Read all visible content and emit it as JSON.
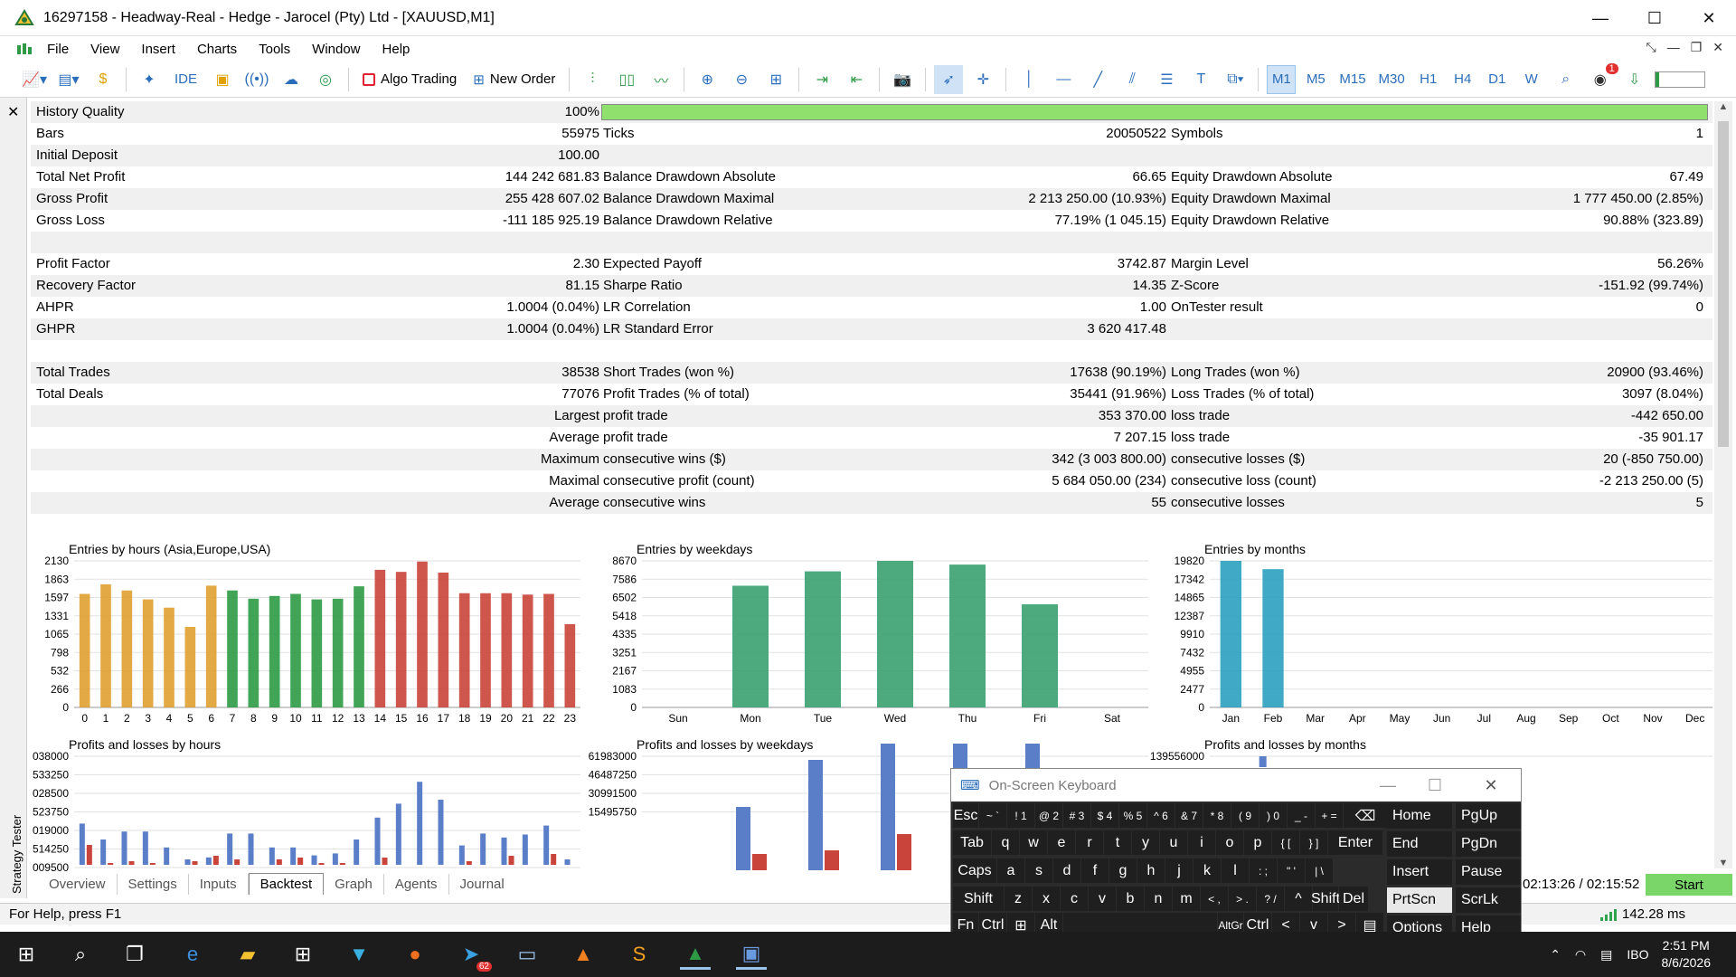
{
  "window": {
    "title": "16297158 - Headway-Real - Hedge - Jarocel (Pty) Ltd - [XAUUSD,M1]",
    "minimize": "—",
    "maximize": "☐",
    "close": "✕"
  },
  "menu": {
    "items": [
      "File",
      "View",
      "Insert",
      "Charts",
      "Tools",
      "Window",
      "Help"
    ]
  },
  "toolbar": {
    "ide_label": "IDE",
    "algo_trading_label": "Algo Trading",
    "new_order_label": "New Order",
    "timeframes": [
      "M1",
      "M5",
      "M15",
      "M30",
      "H1",
      "H4",
      "D1",
      "W"
    ],
    "active_timeframe": "M1",
    "notification_count": "1"
  },
  "sidepanel": {
    "close": "✕",
    "label": "Strategy Tester"
  },
  "report": {
    "rows": [
      {
        "l1": "History Quality",
        "v1": "100%",
        "bar": true,
        "history_quality_fraction": 1.0
      },
      {
        "l1": "Bars",
        "v1": "55975",
        "l2": "Ticks",
        "v2": "20050522",
        "l3": "Symbols",
        "v3": "1"
      },
      {
        "l1": "Initial Deposit",
        "v1": "100.00"
      },
      {
        "l1": "Total Net Profit",
        "v1": "144 242 681.83",
        "l2": "Balance Drawdown Absolute",
        "v2": "66.65",
        "l3": "Equity Drawdown Absolute",
        "v3": "67.49"
      },
      {
        "l1": "Gross Profit",
        "v1": "255 428 607.02",
        "l2": "Balance Drawdown Maximal",
        "v2": "2 213 250.00 (10.93%)",
        "l3": "Equity Drawdown Maximal",
        "v3": "1 777 450.00 (2.85%)"
      },
      {
        "l1": "Gross Loss",
        "v1": "-111 185 925.19",
        "l2": "Balance Drawdown Relative",
        "v2": "77.19% (1 045.15)",
        "l3": "Equity Drawdown Relative",
        "v3": "90.88% (323.89)"
      },
      {},
      {
        "l1": "Profit Factor",
        "v1": "2.30",
        "l2": "Expected Payoff",
        "v2": "3742.87",
        "l3": "Margin Level",
        "v3": "56.26%"
      },
      {
        "l1": "Recovery Factor",
        "v1": "81.15",
        "l2": "Sharpe Ratio",
        "v2": "14.35",
        "l3": "Z-Score",
        "v3": "-151.92 (99.74%)"
      },
      {
        "l1": "AHPR",
        "v1": "1.0004 (0.04%)",
        "l2": "LR Correlation",
        "v2": "1.00",
        "l3": "OnTester result",
        "v3": "0"
      },
      {
        "l1": "GHPR",
        "v1": "1.0004 (0.04%)",
        "l2": "LR Standard Error",
        "v2": "3 620 417.48"
      },
      {},
      {
        "l1": "Total Trades",
        "v1": "38538",
        "l2": "Short Trades (won %)",
        "v2": "17638 (90.19%)",
        "l3": "Long Trades (won %)",
        "v3": "20900 (93.46%)"
      },
      {
        "l1": "Total Deals",
        "v1": "77076",
        "l2": "Profit Trades (% of total)",
        "v2": "35441 (91.96%)",
        "l3": "Loss Trades (% of total)",
        "v3": "3097 (8.04%)"
      },
      {
        "v1": "Largest",
        "l2": "profit trade",
        "v2": "353 370.00",
        "l3": "loss trade",
        "v3": "-442 650.00"
      },
      {
        "v1": "Average",
        "l2": "profit trade",
        "v2": "7 207.15",
        "l3": "loss trade",
        "v3": "-35 901.17"
      },
      {
        "v1": "Maximum",
        "l2": "consecutive wins ($)",
        "v2": "342 (3 003 800.00)",
        "l3": "consecutive losses ($)",
        "v3": "20 (-850 750.00)"
      },
      {
        "v1": "Maximal",
        "l2": "consecutive profit (count)",
        "v2": "5 684 050.00 (234)",
        "l3": "consecutive loss (count)",
        "v3": "-2 213 250.00 (5)"
      },
      {
        "v1": "Average",
        "l2": "consecutive wins",
        "v2": "55",
        "l3": "consecutive losses",
        "v3": "5"
      },
      {}
    ]
  },
  "chart_data": [
    {
      "type": "bar",
      "title": "Entries by hours (Asia,Europe,USA)",
      "categories": [
        "0",
        "1",
        "2",
        "3",
        "4",
        "5",
        "6",
        "7",
        "8",
        "9",
        "10",
        "11",
        "12",
        "13",
        "14",
        "15",
        "16",
        "17",
        "18",
        "19",
        "20",
        "21",
        "22",
        "23"
      ],
      "values": [
        1650,
        1790,
        1700,
        1570,
        1450,
        1170,
        1770,
        1700,
        1580,
        1620,
        1650,
        1570,
        1580,
        1760,
        2000,
        1970,
        2120,
        1960,
        1660,
        1660,
        1660,
        1640,
        1650,
        1210
      ],
      "yticks": [
        "2130",
        "1863",
        "1597",
        "1331",
        "1065",
        "798",
        "532",
        "266",
        "0"
      ],
      "ylim": [
        0,
        2130
      ],
      "colors": {
        "asia": "#e0a030",
        "europe": "#2e9a45",
        "usa": "#c9443a"
      }
    },
    {
      "type": "bar",
      "title": "Entries by weekdays",
      "categories": [
        "Sun",
        "Mon",
        "Tue",
        "Wed",
        "Thu",
        "Fri",
        "Sat"
      ],
      "values": [
        0,
        7200,
        8050,
        8670,
        8450,
        6100,
        0
      ],
      "yticks": [
        "8670",
        "7586",
        "6502",
        "5418",
        "4335",
        "3251",
        "2167",
        "1083",
        "0"
      ],
      "ylim": [
        0,
        8670
      ],
      "colors": {
        "bar": "#3aa070"
      }
    },
    {
      "type": "bar",
      "title": "Entries by months",
      "categories": [
        "Jan",
        "Feb",
        "Mar",
        "Apr",
        "May",
        "Jun",
        "Jul",
        "Aug",
        "Sep",
        "Oct",
        "Nov",
        "Dec"
      ],
      "values": [
        19820,
        18700,
        0,
        0,
        0,
        0,
        0,
        0,
        0,
        0,
        0,
        0
      ],
      "yticks": [
        "19820",
        "17342",
        "14865",
        "12387",
        "9910",
        "7432",
        "4955",
        "2477",
        "0"
      ],
      "ylim": [
        0,
        19820
      ],
      "colors": {
        "bar": "#2aa0c0"
      }
    },
    {
      "type": "bar",
      "title": "Profits and losses by hours",
      "yticks": [
        "038000",
        "533250",
        "028500",
        "523750",
        "019000",
        "514250",
        "009500"
      ],
      "colors": {
        "profit": "#5b7ec9",
        "loss": "#c9443a"
      }
    },
    {
      "type": "bar",
      "title": "Profits and losses by weekdays",
      "yticks": [
        "61983000",
        "46487250",
        "30991500",
        "15495750"
      ],
      "colors": {
        "profit": "#5b7ec9",
        "loss": "#c9443a"
      }
    },
    {
      "type": "bar",
      "title": "Profits and losses by months",
      "yticks": [
        "139556000"
      ],
      "colors": {
        "profit": "#5b7ec9",
        "loss": "#c9443a"
      }
    }
  ],
  "tabs": [
    "Overview",
    "Settings",
    "Inputs",
    "Backtest",
    "Graph",
    "Agents",
    "Journal"
  ],
  "active_tab": "Backtest",
  "timer": "02:13:26 / 02:15:52",
  "start_label": "Start",
  "status": {
    "help": "For Help, press F1",
    "ping": "142.28 ms"
  },
  "osk": {
    "title": "On-Screen Keyboard",
    "rows": [
      [
        "Esc",
        "~ `",
        "! 1",
        "@ 2",
        "# 3",
        "$ 4",
        "% 5",
        "^ 6",
        "& 7",
        "* 8",
        "( 9",
        ") 0",
        "_ -",
        "+ =",
        "⌫"
      ],
      [
        "Tab",
        "q",
        "w",
        "e",
        "r",
        "t",
        "y",
        "u",
        "i",
        "o",
        "p",
        "{ [",
        "} ]",
        "Enter"
      ],
      [
        "Caps",
        "a",
        "s",
        "d",
        "f",
        "g",
        "h",
        "j",
        "k",
        "l",
        ": ;",
        "\" '",
        "| \\"
      ],
      [
        "Shift",
        "z",
        "x",
        "c",
        "v",
        "b",
        "n",
        "m",
        "< ,",
        "> .",
        "? /",
        "^",
        "Shift",
        "Del"
      ],
      [
        "Fn",
        "Ctrl",
        "⊞",
        "Alt",
        "",
        "AltGr",
        "Ctrl",
        "<",
        "v",
        ">",
        "▤"
      ]
    ],
    "side": [
      "Home",
      "PgUp",
      "End",
      "PgDn",
      "Insert",
      "Pause",
      "PrtScn",
      "ScrLk",
      "Options",
      "Help"
    ],
    "highlighted": "PrtScn"
  },
  "taskbar": {
    "telegram_badge": "62",
    "tray_label": "IBO",
    "time": "2:51 PM",
    "date": "8/6/2026"
  }
}
